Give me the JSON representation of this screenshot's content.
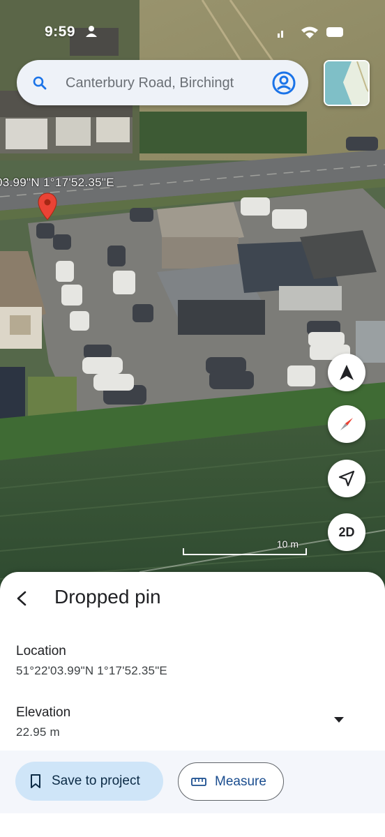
{
  "status_bar": {
    "time": "9:59"
  },
  "search": {
    "placeholder": "Canterbury Road, Birchingt"
  },
  "map": {
    "coordinate_overlay": "03.99\"N 1°17'52.35\"E",
    "scale_label": "10 m",
    "view_mode_label": "2D"
  },
  "sheet": {
    "title": "Dropped pin",
    "location_label": "Location",
    "location_value": "51°22'03.99\"N 1°17'52.35\"E",
    "elevation_label": "Elevation",
    "elevation_value": "22.95 m",
    "save_label": "Save to project",
    "measure_label": "Measure"
  },
  "colors": {
    "accent_blue": "#1a73e8",
    "pin_red": "#ea4335",
    "save_button_bg": "#cfe5f8"
  },
  "icons": [
    "search-icon",
    "account-icon",
    "map-layer-thumbnail",
    "location-pin-icon",
    "navigation-arrow-icon",
    "compass-icon",
    "my-location-icon",
    "back-arrow-icon",
    "dropdown-arrow-icon",
    "bookmark-icon",
    "ruler-icon"
  ]
}
